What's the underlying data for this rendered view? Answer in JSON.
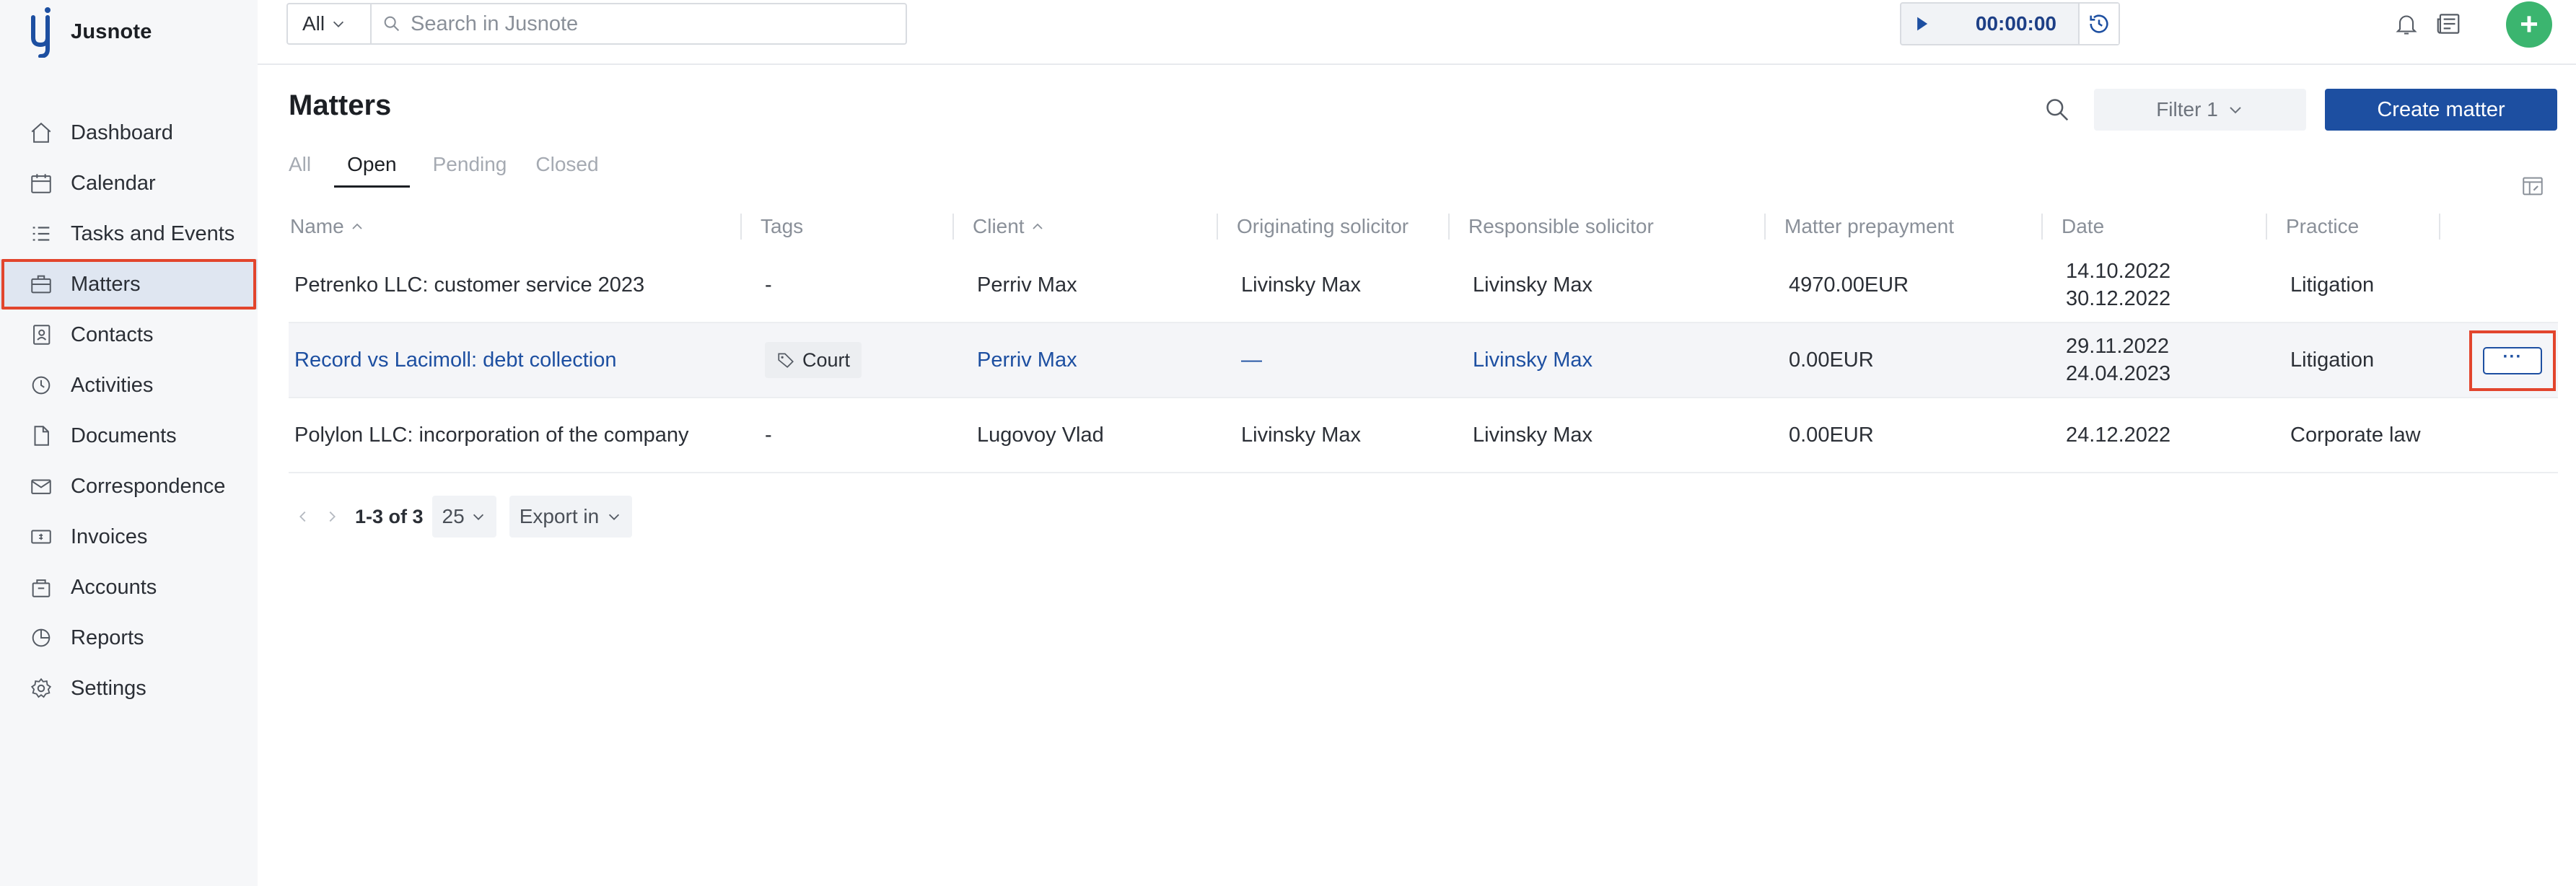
{
  "app": {
    "name": "Jusnote"
  },
  "sidebar": {
    "items": [
      {
        "label": "Dashboard",
        "icon": "home-icon"
      },
      {
        "label": "Calendar",
        "icon": "calendar-icon"
      },
      {
        "label": "Tasks and Events",
        "icon": "tasks-icon"
      },
      {
        "label": "Matters",
        "icon": "briefcase-icon",
        "active": true
      },
      {
        "label": "Contacts",
        "icon": "contacts-icon"
      },
      {
        "label": "Activities",
        "icon": "activities-icon"
      },
      {
        "label": "Documents",
        "icon": "documents-icon"
      },
      {
        "label": "Correspondence",
        "icon": "correspondence-icon"
      },
      {
        "label": "Invoices",
        "icon": "invoices-icon"
      },
      {
        "label": "Accounts",
        "icon": "accounts-icon"
      },
      {
        "label": "Reports",
        "icon": "reports-icon"
      },
      {
        "label": "Settings",
        "icon": "gear-icon"
      }
    ]
  },
  "topbar": {
    "scope": "All",
    "search_placeholder": "Search in Jusnote",
    "timer": "00:00:00",
    "add_label": "+"
  },
  "page": {
    "title": "Matters",
    "filter_label": "Filter 1",
    "create_label": "Create matter",
    "tabs": [
      "All",
      "Open",
      "Pending",
      "Closed"
    ],
    "active_tab": "Open"
  },
  "table": {
    "columns": [
      "Name",
      "Tags",
      "Client",
      "Originating solicitor",
      "Responsible solicitor",
      "Matter prepayment",
      "Date",
      "Practice"
    ],
    "rows": [
      {
        "name": "Petrenko LLC: customer service 2023",
        "tags": "-",
        "client": "Perriv Max",
        "originating": "Livinsky Max",
        "responsible": "Livinsky Max",
        "prepayment": "4970.00EUR",
        "date1": "14.10.2022",
        "date2": "30.12.2022",
        "practice": "Litigation"
      },
      {
        "name": "Record vs Lacimoll: debt collection",
        "tags": "Court",
        "client": "Perriv Max",
        "originating": "—",
        "responsible": "Livinsky Max",
        "prepayment": "0.00EUR",
        "date1": "29.11.2022",
        "date2": "24.04.2023",
        "practice": "Litigation",
        "more": "···"
      },
      {
        "name": "Polylon LLC: incorporation of the company",
        "tags": "-",
        "client": "Lugovoy Vlad",
        "originating": "Livinsky Max",
        "responsible": "Livinsky Max",
        "prepayment": "0.00EUR",
        "date1": "24.12.2022",
        "date2": "",
        "practice": "Corporate law"
      }
    ]
  },
  "pager": {
    "range": "1-3 of 3",
    "page_size": "25",
    "export_label": "Export in"
  },
  "colors": {
    "accent": "#1d4fa1",
    "highlight": "#e2452d",
    "add": "#3bb56f"
  }
}
